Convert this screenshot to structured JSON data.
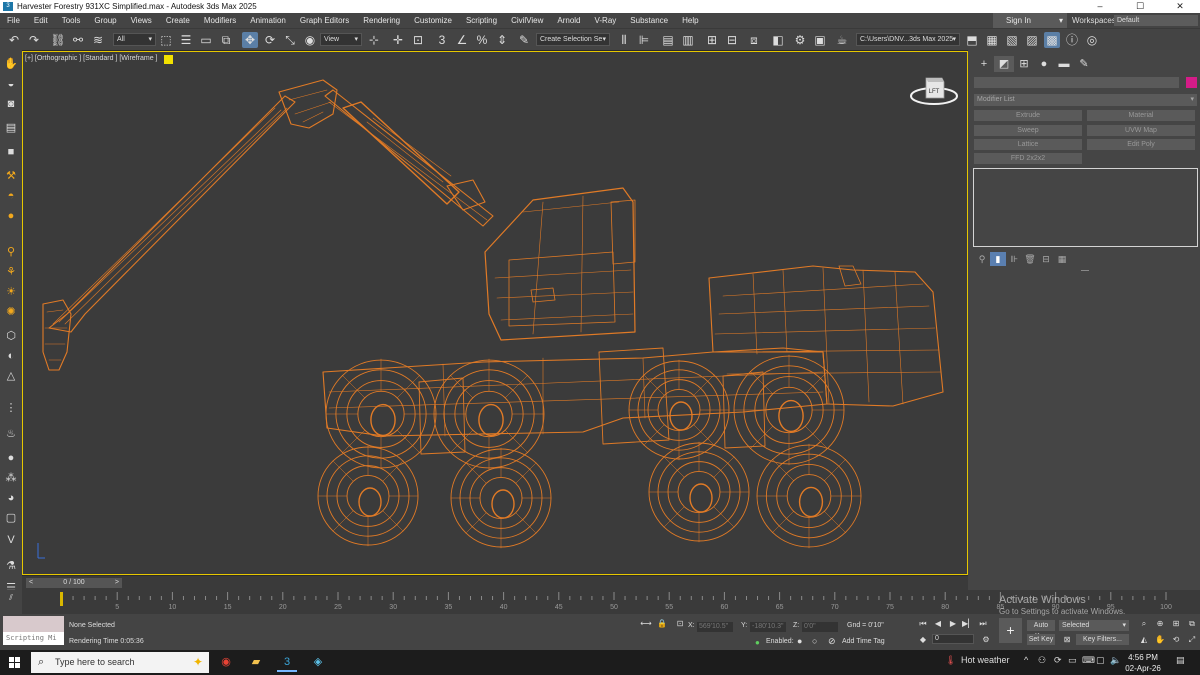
{
  "window": {
    "title": "Harvester Forestry 931XC Simplified.max - Autodesk 3ds Max 2025",
    "app_icon": "3",
    "controls": {
      "minimize": "–",
      "maximize": "☐",
      "close": "✕"
    }
  },
  "menu": [
    "File",
    "Edit",
    "Tools",
    "Group",
    "Views",
    "Create",
    "Modifiers",
    "Animation",
    "Graph Editors",
    "Rendering",
    "Customize",
    "Scripting",
    "CivilView",
    "Arnold",
    "V-Ray",
    "Substance",
    "Help"
  ],
  "account": {
    "sign_in": "Sign In",
    "workspaces_label": "Workspaces:",
    "workspace": "Default"
  },
  "toolbar": {
    "selection_filter": "All",
    "ref_coord": "View",
    "named_selection": "Create Selection Se",
    "project_path": "C:\\Users\\DNV...3ds Max 2025"
  },
  "viewport": {
    "label": "[+] [Orthographic ] [Standard ] [Wireframe ]",
    "viewcube_face": "LFT",
    "wire_color": "#e07a26",
    "border_color": "#e6c700"
  },
  "command_panel": {
    "modifier_list": "Modifier List",
    "modifier_buttons": [
      "Extrude",
      "Material",
      "Sweep",
      "UVW Map",
      "Lattice",
      "Edit Poly",
      "FFD 2x2x2"
    ],
    "object_color": "#d51c88"
  },
  "timeline": {
    "slider": "0 / 100",
    "ticks": [
      "5",
      "10",
      "15",
      "20",
      "25",
      "30",
      "35",
      "40",
      "45",
      "50",
      "55",
      "60",
      "65",
      "70",
      "75",
      "80",
      "85",
      "90",
      "95",
      "100"
    ]
  },
  "status": {
    "maxscript_listener": "Scripting Mi",
    "selection": "None Selected",
    "render_time": "Rendering Time  0:05:36",
    "x_label": "X:",
    "x_value": "569'10.5\"",
    "y_label": "Y:",
    "y_value": "-180'10.3\"",
    "z_label": "Z:",
    "z_value": "0'0\"",
    "grid": "Gnd = 0'10\"",
    "enabled_label": "Enabled:",
    "add_time_tag": "Add Time Tag",
    "frame": "0",
    "auto_key": "Auto Key",
    "set_key": "Set Key",
    "key_mode": "Selected",
    "key_filters": "Key Filters..."
  },
  "activation": {
    "line1": "Activate Windows",
    "line2": "Go to Settings to activate Windows."
  },
  "taskbar": {
    "search_placeholder": "Type here to search",
    "weather": "Hot weather",
    "time": "4:56 PM",
    "date": "02-Apr-26"
  }
}
